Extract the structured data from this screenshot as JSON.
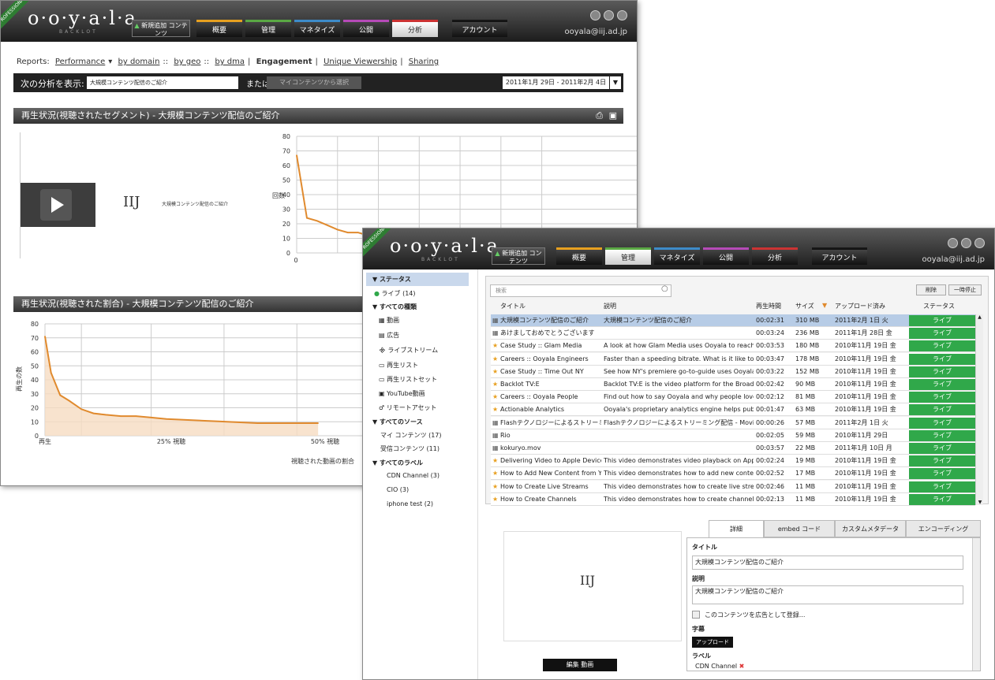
{
  "app": {
    "logo": "o·o·y·a·l·a",
    "logo_sub": "BACKLOT",
    "pro_badge": "PROFESSIONAL",
    "email": "ooyala@iij.ad.jp",
    "nav": [
      "新規追加 コンテンツ",
      "概要",
      "管理",
      "マネタイズ",
      "公開",
      "分析",
      "アカウント"
    ]
  },
  "analytics": {
    "reports_label": "Reports:",
    "report_links": [
      "Performance",
      "by domain",
      "by geo",
      "by dma"
    ],
    "report_tabs": [
      "Engagement",
      "Unique Viewership",
      "Sharing"
    ],
    "analyze_label": "次の分析を表示:",
    "analyze_value": "大規模コンテンツ配信のご紹介",
    "or_label": "または",
    "select_btn": "マイコンテンツから選択",
    "date_range": "2011年1月 29日 - 2011年2月 4日",
    "section1_title": "再生状況(視聴されたセグメント) - 大規模コンテンツ配信のご紹介",
    "section2_title": "再生状況(視聴された割合) - 大規模コンテンツ配信のご紹介",
    "video_label": "大規模コンテンツ配信のご紹介",
    "iij": "IIJ",
    "ylabel1": "回数",
    "ylabel2": "再生の数",
    "x_labels2": [
      "再生",
      "25% 視聴",
      "50% 視聴"
    ],
    "xlabel2": "視聴された動画の割合"
  },
  "chart_data": [
    {
      "type": "line",
      "title": "",
      "ylabel": "回数",
      "ylim": [
        0,
        80
      ],
      "yticks": [
        0,
        10,
        20,
        30,
        40,
        50,
        60,
        70,
        80
      ],
      "x": [
        0,
        1,
        2,
        3,
        4,
        5,
        6,
        7,
        8,
        9,
        10
      ],
      "values": [
        67,
        24,
        22,
        19,
        16,
        14,
        14,
        12,
        10,
        9,
        9
      ]
    },
    {
      "type": "area",
      "title": "",
      "ylabel": "再生の数",
      "ylim": [
        0,
        80
      ],
      "yticks": [
        0,
        10,
        20,
        30,
        40,
        50,
        60,
        70,
        80
      ],
      "categories": [
        "再生",
        "25% 視聴",
        "50% 視聴"
      ],
      "x": [
        0,
        2,
        5,
        8,
        12,
        16,
        20,
        25,
        30,
        35,
        40,
        50,
        60,
        70,
        80,
        90
      ],
      "values": [
        71,
        45,
        29,
        25,
        19,
        16,
        15,
        14,
        14,
        13,
        12,
        11,
        10,
        9,
        9,
        9
      ]
    }
  ],
  "manager": {
    "sidebar": {
      "status_header": "ステータス",
      "live": "ライブ (14)",
      "all_types_header": "すべての種類",
      "types": [
        "動画",
        "広告",
        "ライブストリーム",
        "再生リスト",
        "再生リストセット",
        "YouTube動画",
        "リモートアセット"
      ],
      "all_sources_header": "すべてのソース",
      "sources": [
        "マイ コンテンツ (17)",
        "受信コンテンツ (11)"
      ],
      "all_labels_header": "すべてのラベル",
      "labels": [
        "CDN Channel (3)",
        "CIO (3)",
        "iphone test (2)"
      ]
    },
    "search_placeholder": "検索",
    "btn_delete": "削除",
    "btn_pause": "一時停止",
    "columns": [
      "タイトル",
      "説明",
      "再生時間",
      "サイズ",
      "アップロード済み",
      "ステータス"
    ],
    "rows": [
      [
        "大規模コンテンツ配信のご紹介",
        "大規模コンテンツ配信のご紹介",
        "00:02:31",
        "310 MB",
        "2011年2月 1日 火",
        "ライブ"
      ],
      [
        "あけましておめでとうございます",
        "",
        "00:03:24",
        "236 MB",
        "2011年1月 28日 金",
        "ライブ"
      ],
      [
        "Case Study :: Glam Media",
        "A look at how Glam Media uses Ooyala to reach m",
        "00:03:53",
        "180 MB",
        "2010年11月 19日 金",
        "ライブ"
      ],
      [
        "Careers :: Ooyala Engineers",
        "Faster than a speeding bitrate. What is it like to be",
        "00:03:47",
        "178 MB",
        "2010年11月 19日 金",
        "ライブ"
      ],
      [
        "Case Study :: Time Out NY",
        "See how NY's premiere go-to-guide uses Ooyala to",
        "00:03:22",
        "152 MB",
        "2010年11月 19日 金",
        "ライブ"
      ],
      [
        "Backlot TV:E",
        "Backlot TV:E is the video platform for the Broadcas",
        "00:02:42",
        "90 MB",
        "2010年11月 19日 金",
        "ライブ"
      ],
      [
        "Careers :: Ooyala People",
        "Find out how to say Ooyala and why people love w",
        "00:02:12",
        "81 MB",
        "2010年11月 19日 金",
        "ライブ"
      ],
      [
        "Actionable Analytics",
        "Ooyala's proprietary analytics engine helps publish",
        "00:01:47",
        "63 MB",
        "2010年11月 19日 金",
        "ライブ"
      ],
      [
        "Flashテクノロジーによるストリーミング",
        "Flashテクノロジーによるストリーミング配信 - Movie Int",
        "00:00:26",
        "57 MB",
        "2011年2月 1日 火",
        "ライブ"
      ],
      [
        "Rio",
        "",
        "00:02:05",
        "59 MB",
        "2010年11月 29日",
        "ライブ"
      ],
      [
        "kokuryo.mov",
        "",
        "00:03:57",
        "22 MB",
        "2011年1月 10日 月",
        "ライブ"
      ],
      [
        "Delivering Video to Apple Devices",
        "This video demonstrates video playback on Apple c",
        "00:02:24",
        "19 MB",
        "2010年11月 19日 金",
        "ライブ"
      ],
      [
        "How to Add New Content from Yo",
        "This video demonstrates how to add new content fr",
        "00:02:52",
        "17 MB",
        "2010年11月 19日 金",
        "ライブ"
      ],
      [
        "How to Create Live Streams",
        "This video demonstrates how to create live streams",
        "00:02:46",
        "11 MB",
        "2010年11月 19日 金",
        "ライブ"
      ],
      [
        "How to Create Channels",
        "This video demonstrates how to create channels",
        "00:02:13",
        "11 MB",
        "2010年11月 19日 金",
        "ライブ"
      ]
    ],
    "tabs": [
      "詳細",
      "embed コード",
      "カスタムメタデータ",
      "エンコーディング"
    ],
    "detail": {
      "title_label": "タイトル",
      "title_value": "大規模コンテンツ配信のご紹介",
      "desc_label": "説明",
      "desc_value": "大規模コンテンツ配信のご紹介",
      "ad_checkbox": "このコンテンツを広告として登録...",
      "subtitle_label": "字幕",
      "upload_btn": "アップロード",
      "label_label": "ラベル",
      "label_chip": "CDN Channel"
    },
    "edit_video_btn": "編集 動画",
    "iij": "IIJ"
  },
  "colors": {
    "accent_orange": "#e08a2e",
    "live_green": "#30a84a",
    "selected_row": "#b7cce6"
  }
}
